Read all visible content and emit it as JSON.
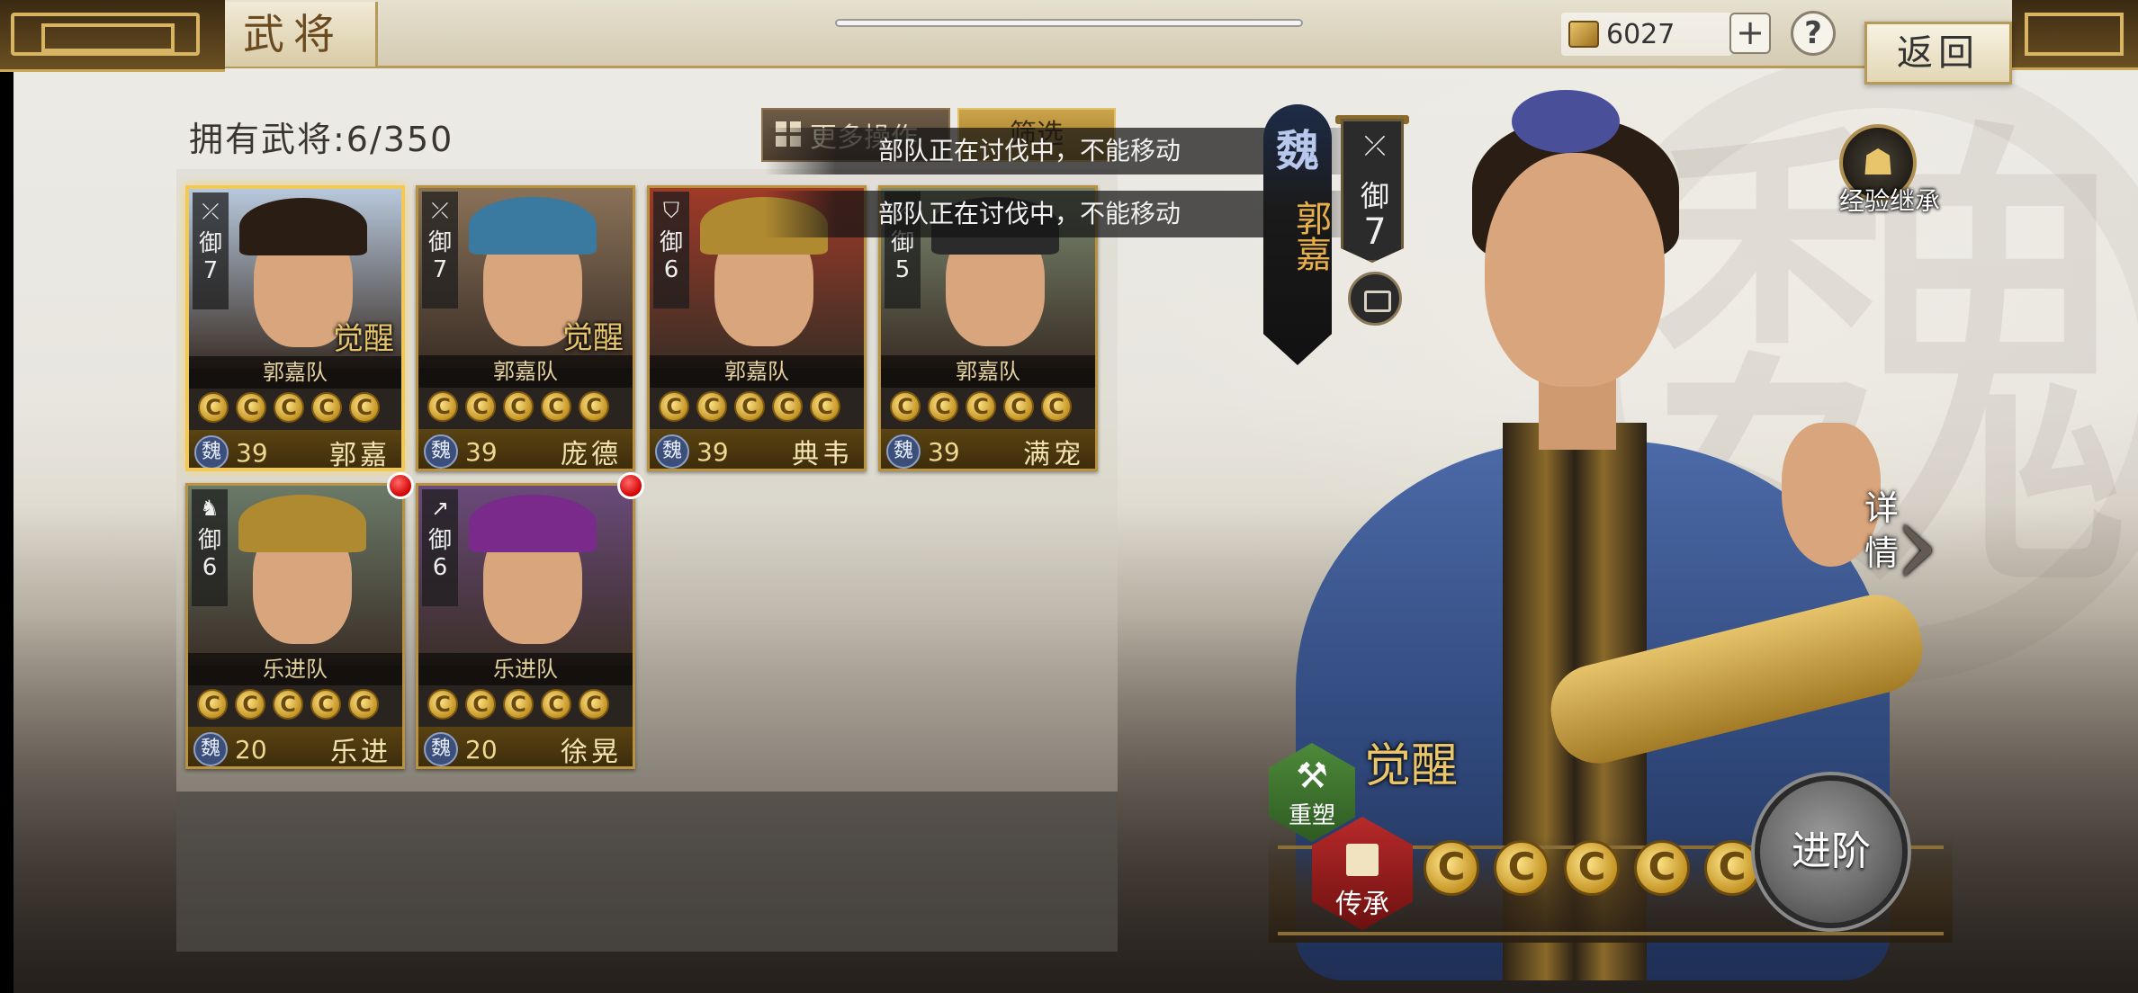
{
  "header": {
    "title": "武将",
    "currency": {
      "value": "6027",
      "icon": "gold-coin-icon"
    },
    "add_label": "+",
    "help_label": "?",
    "back_label": "返回"
  },
  "roster": {
    "owned_label": "拥有武将:6/350",
    "more_ops_label": "更多操作",
    "filter_label": "筛选",
    "toasts": [
      "部队正在讨伐中，不能移动",
      "部队正在讨伐中，不能移动"
    ],
    "heroes": [
      {
        "name": "郭嘉",
        "team": "郭嘉队",
        "level": "39",
        "faction": "魏",
        "unit_icon": "archer-icon",
        "stat_label": "御",
        "stat_value": "7",
        "stars": 5,
        "awakened": true,
        "awaken_label": "觉醒",
        "selected": true,
        "new": false
      },
      {
        "name": "庞德",
        "team": "郭嘉队",
        "level": "39",
        "faction": "魏",
        "unit_icon": "archer-icon",
        "stat_label": "御",
        "stat_value": "7",
        "stars": 5,
        "awakened": true,
        "awaken_label": "觉醒",
        "selected": false,
        "new": false
      },
      {
        "name": "典韦",
        "team": "郭嘉队",
        "level": "39",
        "faction": "魏",
        "unit_icon": "shield-icon",
        "stat_label": "御",
        "stat_value": "6",
        "stars": 5,
        "awakened": false,
        "awaken_label": "",
        "selected": false,
        "new": false
      },
      {
        "name": "满宠",
        "team": "郭嘉队",
        "level": "39",
        "faction": "魏",
        "unit_icon": "archer-icon",
        "stat_label": "御",
        "stat_value": "5",
        "stars": 5,
        "awakened": false,
        "awaken_label": "",
        "selected": false,
        "new": false
      },
      {
        "name": "乐进",
        "team": "乐进队",
        "level": "20",
        "faction": "魏",
        "unit_icon": "cavalry-icon",
        "stat_label": "御",
        "stat_value": "6",
        "stars": 5,
        "awakened": false,
        "awaken_label": "",
        "selected": false,
        "new": true
      },
      {
        "name": "徐晃",
        "team": "乐进队",
        "level": "20",
        "faction": "魏",
        "unit_icon": "spear-icon",
        "stat_label": "御",
        "stat_value": "6",
        "stars": 5,
        "awakened": false,
        "awaken_label": "",
        "selected": false,
        "new": true
      }
    ]
  },
  "detail": {
    "kingdom": "魏",
    "name": "郭嘉",
    "unit_icon": "archer-icon",
    "stat_label": "御",
    "stat_value": "7",
    "exp_inherit_label": "经验继承",
    "details_label": "详情",
    "remold_label": "重塑",
    "awaken_label": "觉醒",
    "inherit_label": "传承",
    "advance_label": "进阶",
    "stars": 5,
    "watermark": "魏"
  },
  "colors": {
    "gold": "#e8c56a",
    "wei_blue": "#3b4f7a",
    "red_dot": "#d30000",
    "remold_green": "#2e5a22",
    "inherit_red": "#b82a2a"
  }
}
